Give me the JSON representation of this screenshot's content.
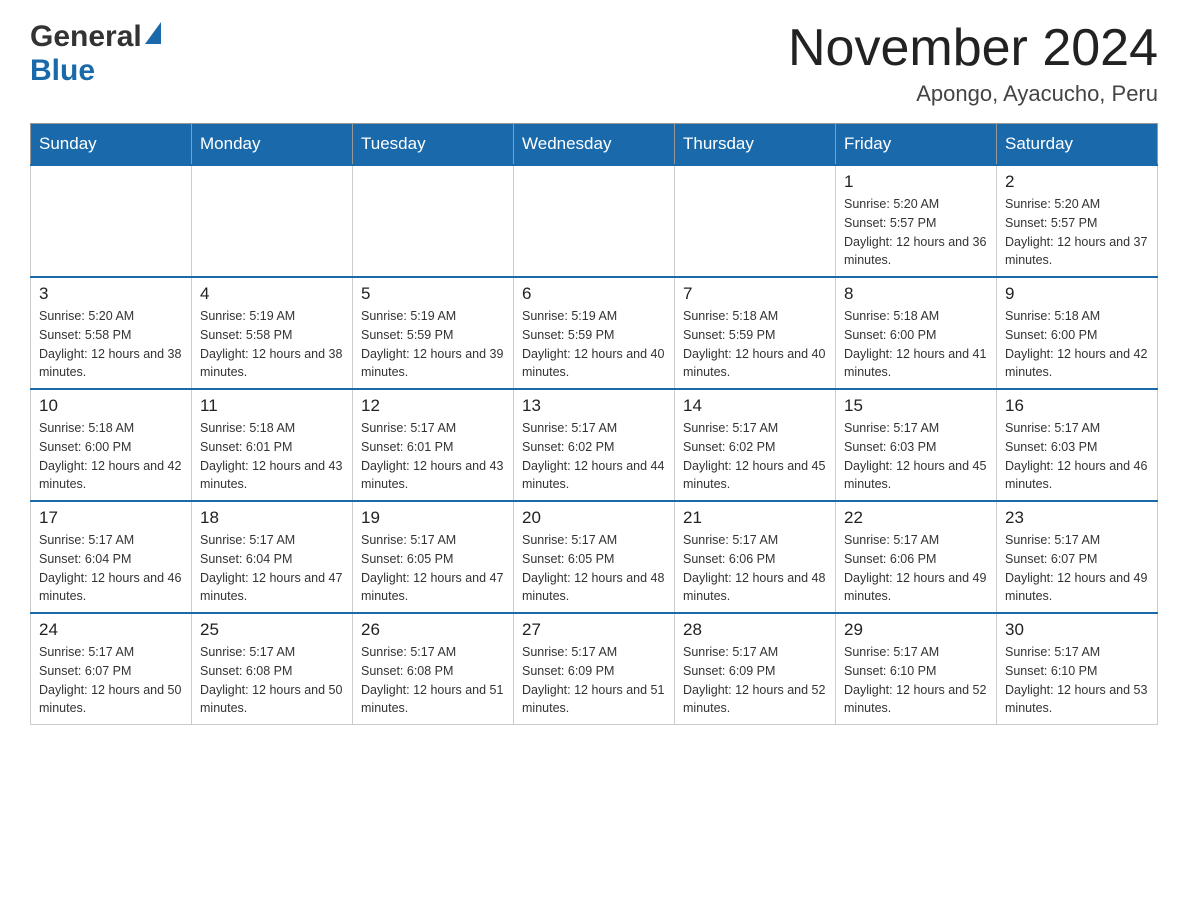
{
  "header": {
    "logo_general": "General",
    "logo_blue": "Blue",
    "month_year": "November 2024",
    "location": "Apongo, Ayacucho, Peru"
  },
  "days_of_week": [
    "Sunday",
    "Monday",
    "Tuesday",
    "Wednesday",
    "Thursday",
    "Friday",
    "Saturday"
  ],
  "weeks": [
    [
      {
        "day": "",
        "sunrise": "",
        "sunset": "",
        "daylight": ""
      },
      {
        "day": "",
        "sunrise": "",
        "sunset": "",
        "daylight": ""
      },
      {
        "day": "",
        "sunrise": "",
        "sunset": "",
        "daylight": ""
      },
      {
        "day": "",
        "sunrise": "",
        "sunset": "",
        "daylight": ""
      },
      {
        "day": "",
        "sunrise": "",
        "sunset": "",
        "daylight": ""
      },
      {
        "day": "1",
        "sunrise": "Sunrise: 5:20 AM",
        "sunset": "Sunset: 5:57 PM",
        "daylight": "Daylight: 12 hours and 36 minutes."
      },
      {
        "day": "2",
        "sunrise": "Sunrise: 5:20 AM",
        "sunset": "Sunset: 5:57 PM",
        "daylight": "Daylight: 12 hours and 37 minutes."
      }
    ],
    [
      {
        "day": "3",
        "sunrise": "Sunrise: 5:20 AM",
        "sunset": "Sunset: 5:58 PM",
        "daylight": "Daylight: 12 hours and 38 minutes."
      },
      {
        "day": "4",
        "sunrise": "Sunrise: 5:19 AM",
        "sunset": "Sunset: 5:58 PM",
        "daylight": "Daylight: 12 hours and 38 minutes."
      },
      {
        "day": "5",
        "sunrise": "Sunrise: 5:19 AM",
        "sunset": "Sunset: 5:59 PM",
        "daylight": "Daylight: 12 hours and 39 minutes."
      },
      {
        "day": "6",
        "sunrise": "Sunrise: 5:19 AM",
        "sunset": "Sunset: 5:59 PM",
        "daylight": "Daylight: 12 hours and 40 minutes."
      },
      {
        "day": "7",
        "sunrise": "Sunrise: 5:18 AM",
        "sunset": "Sunset: 5:59 PM",
        "daylight": "Daylight: 12 hours and 40 minutes."
      },
      {
        "day": "8",
        "sunrise": "Sunrise: 5:18 AM",
        "sunset": "Sunset: 6:00 PM",
        "daylight": "Daylight: 12 hours and 41 minutes."
      },
      {
        "day": "9",
        "sunrise": "Sunrise: 5:18 AM",
        "sunset": "Sunset: 6:00 PM",
        "daylight": "Daylight: 12 hours and 42 minutes."
      }
    ],
    [
      {
        "day": "10",
        "sunrise": "Sunrise: 5:18 AM",
        "sunset": "Sunset: 6:00 PM",
        "daylight": "Daylight: 12 hours and 42 minutes."
      },
      {
        "day": "11",
        "sunrise": "Sunrise: 5:18 AM",
        "sunset": "Sunset: 6:01 PM",
        "daylight": "Daylight: 12 hours and 43 minutes."
      },
      {
        "day": "12",
        "sunrise": "Sunrise: 5:17 AM",
        "sunset": "Sunset: 6:01 PM",
        "daylight": "Daylight: 12 hours and 43 minutes."
      },
      {
        "day": "13",
        "sunrise": "Sunrise: 5:17 AM",
        "sunset": "Sunset: 6:02 PM",
        "daylight": "Daylight: 12 hours and 44 minutes."
      },
      {
        "day": "14",
        "sunrise": "Sunrise: 5:17 AM",
        "sunset": "Sunset: 6:02 PM",
        "daylight": "Daylight: 12 hours and 45 minutes."
      },
      {
        "day": "15",
        "sunrise": "Sunrise: 5:17 AM",
        "sunset": "Sunset: 6:03 PM",
        "daylight": "Daylight: 12 hours and 45 minutes."
      },
      {
        "day": "16",
        "sunrise": "Sunrise: 5:17 AM",
        "sunset": "Sunset: 6:03 PM",
        "daylight": "Daylight: 12 hours and 46 minutes."
      }
    ],
    [
      {
        "day": "17",
        "sunrise": "Sunrise: 5:17 AM",
        "sunset": "Sunset: 6:04 PM",
        "daylight": "Daylight: 12 hours and 46 minutes."
      },
      {
        "day": "18",
        "sunrise": "Sunrise: 5:17 AM",
        "sunset": "Sunset: 6:04 PM",
        "daylight": "Daylight: 12 hours and 47 minutes."
      },
      {
        "day": "19",
        "sunrise": "Sunrise: 5:17 AM",
        "sunset": "Sunset: 6:05 PM",
        "daylight": "Daylight: 12 hours and 47 minutes."
      },
      {
        "day": "20",
        "sunrise": "Sunrise: 5:17 AM",
        "sunset": "Sunset: 6:05 PM",
        "daylight": "Daylight: 12 hours and 48 minutes."
      },
      {
        "day": "21",
        "sunrise": "Sunrise: 5:17 AM",
        "sunset": "Sunset: 6:06 PM",
        "daylight": "Daylight: 12 hours and 48 minutes."
      },
      {
        "day": "22",
        "sunrise": "Sunrise: 5:17 AM",
        "sunset": "Sunset: 6:06 PM",
        "daylight": "Daylight: 12 hours and 49 minutes."
      },
      {
        "day": "23",
        "sunrise": "Sunrise: 5:17 AM",
        "sunset": "Sunset: 6:07 PM",
        "daylight": "Daylight: 12 hours and 49 minutes."
      }
    ],
    [
      {
        "day": "24",
        "sunrise": "Sunrise: 5:17 AM",
        "sunset": "Sunset: 6:07 PM",
        "daylight": "Daylight: 12 hours and 50 minutes."
      },
      {
        "day": "25",
        "sunrise": "Sunrise: 5:17 AM",
        "sunset": "Sunset: 6:08 PM",
        "daylight": "Daylight: 12 hours and 50 minutes."
      },
      {
        "day": "26",
        "sunrise": "Sunrise: 5:17 AM",
        "sunset": "Sunset: 6:08 PM",
        "daylight": "Daylight: 12 hours and 51 minutes."
      },
      {
        "day": "27",
        "sunrise": "Sunrise: 5:17 AM",
        "sunset": "Sunset: 6:09 PM",
        "daylight": "Daylight: 12 hours and 51 minutes."
      },
      {
        "day": "28",
        "sunrise": "Sunrise: 5:17 AM",
        "sunset": "Sunset: 6:09 PM",
        "daylight": "Daylight: 12 hours and 52 minutes."
      },
      {
        "day": "29",
        "sunrise": "Sunrise: 5:17 AM",
        "sunset": "Sunset: 6:10 PM",
        "daylight": "Daylight: 12 hours and 52 minutes."
      },
      {
        "day": "30",
        "sunrise": "Sunrise: 5:17 AM",
        "sunset": "Sunset: 6:10 PM",
        "daylight": "Daylight: 12 hours and 53 minutes."
      }
    ]
  ]
}
